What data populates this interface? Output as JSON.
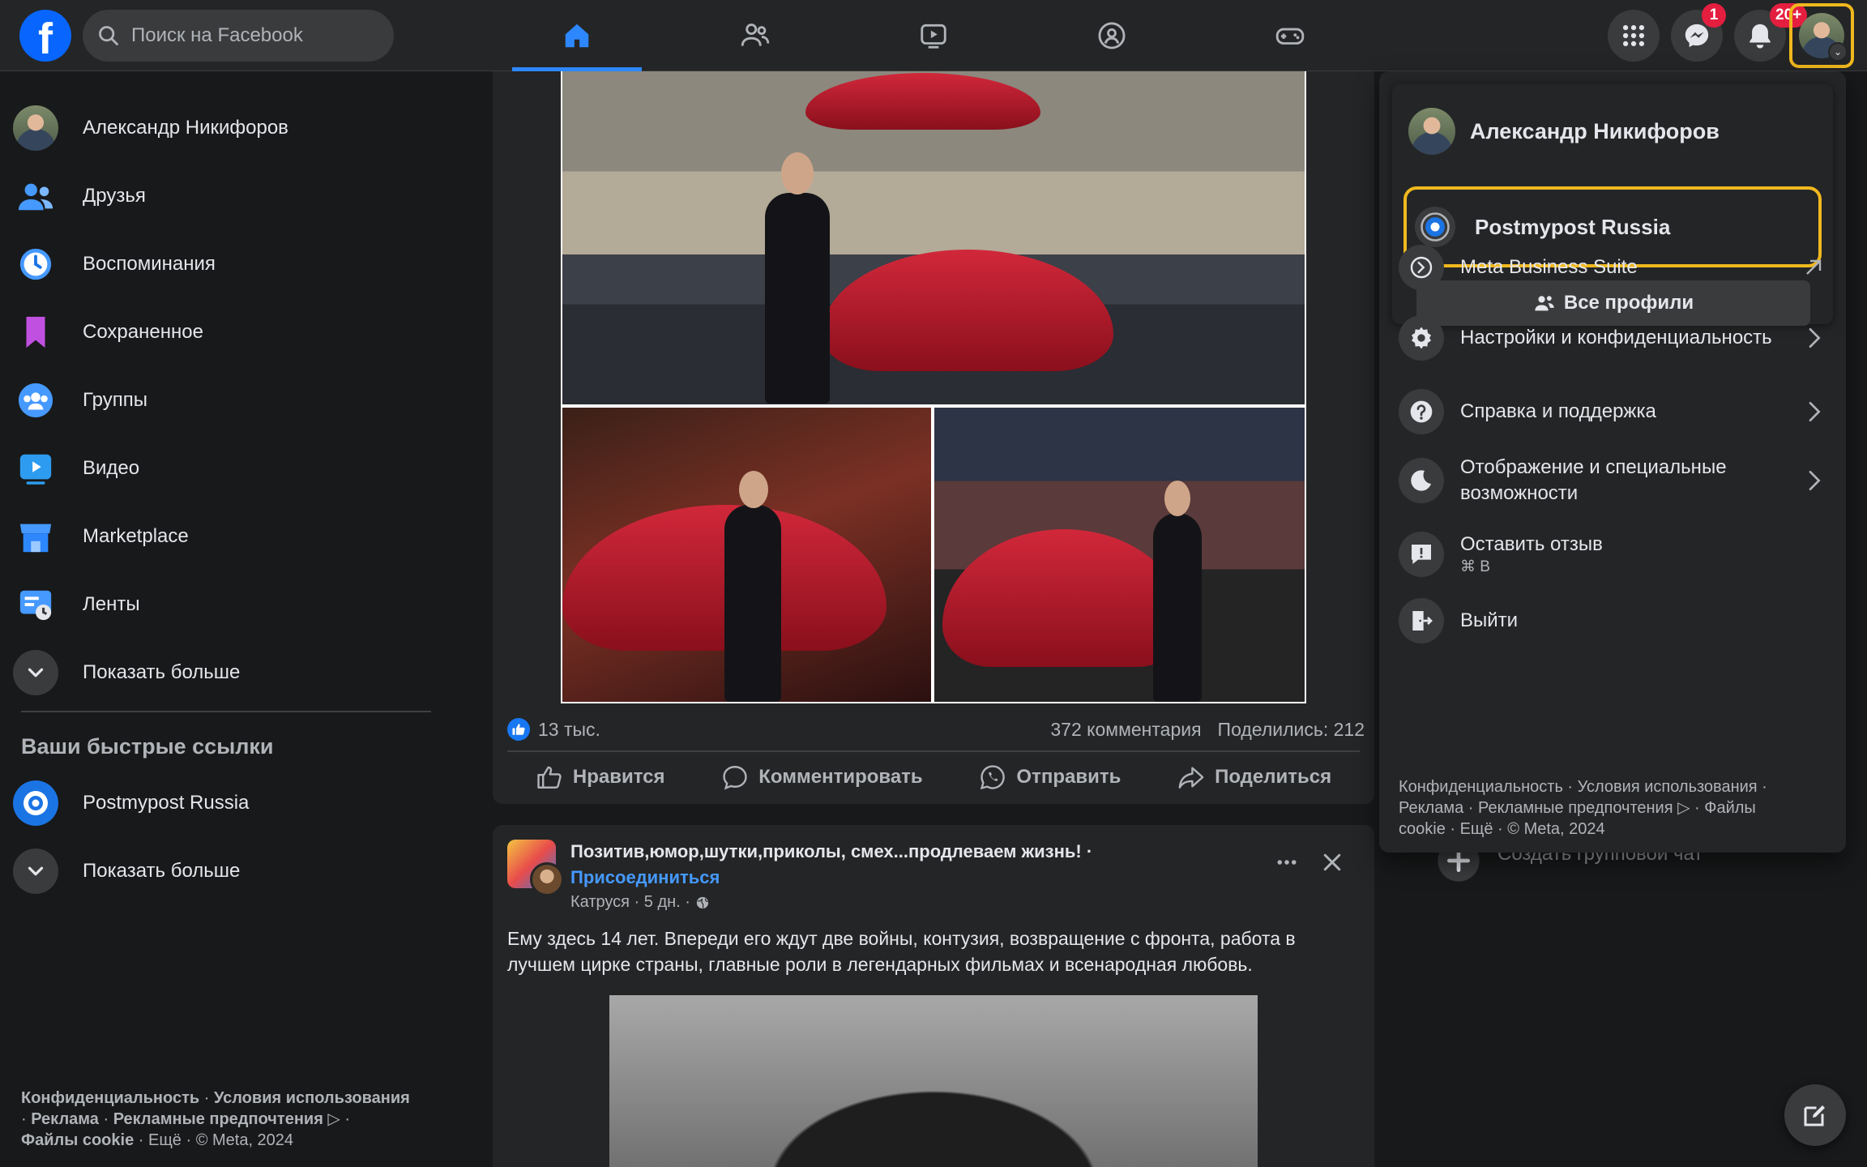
{
  "topbar": {
    "search_placeholder": "Поиск на Facebook",
    "notifications": {
      "messenger_count": "1",
      "bell_count": "20+"
    }
  },
  "left": {
    "items": [
      {
        "label": "Александр Никифоров",
        "icon": "profile-avatar"
      },
      {
        "label": "Друзья",
        "icon": "friends-icon"
      },
      {
        "label": "Воспоминания",
        "icon": "memories-clock-icon"
      },
      {
        "label": "Сохраненное",
        "icon": "saved-bookmark-icon"
      },
      {
        "label": "Группы",
        "icon": "groups-icon"
      },
      {
        "label": "Видео",
        "icon": "video-icon"
      },
      {
        "label": "Marketplace",
        "icon": "marketplace-shop-icon"
      },
      {
        "label": "Ленты",
        "icon": "feeds-icon"
      },
      {
        "label": "Показать больше",
        "icon": "chevron-down-icon"
      }
    ],
    "shortcuts_title": "Ваши быстрые ссылки",
    "shortcuts": [
      {
        "label": "Postmypost Russia"
      },
      {
        "label": "Показать больше"
      }
    ],
    "footer": {
      "privacy": "Конфиденциальность",
      "terms": "Условия использования",
      "ads": "Реклама",
      "ad_choices": "Рекламные предпочтения",
      "cookies": "Файлы cookie",
      "more": "Ещё",
      "copyright": "© Meta, 2024"
    }
  },
  "post1": {
    "likes": "13 тыс.",
    "comments": "372 комментария",
    "shares": "Поделились: 212",
    "actions": {
      "like": "Нравится",
      "comment": "Комментировать",
      "send": "Отправить",
      "share": "Поделиться"
    }
  },
  "post2": {
    "group": "Позитив,юмор,шутки,приколы, смех...продлеваем жизнь! ·",
    "join": "Присоединиться",
    "author_time": "Катруся · 5 дн. ·",
    "text": "Ему здесь 14 лет. Впереди его ждут две войны, контузия, возвращение с фронта, работа в лучшем цирке страны, главные роли в легендарных фильмах и всенародная любовь."
  },
  "right": {
    "hidden_item": "Создать групповой чат"
  },
  "menu": {
    "profile_name": "Александр Никифоров",
    "page_name": "Postmypost Russia",
    "all_profiles": "Все профили",
    "items": [
      {
        "label": "Meta Business Suite",
        "icon": "meta-business-icon",
        "arrow": "external-link-icon"
      },
      {
        "label": "Настройки и конфиденциальность",
        "icon": "gear-icon",
        "arrow": "chevron-right-icon"
      },
      {
        "label": "Справка и поддержка",
        "icon": "help-icon",
        "arrow": "chevron-right-icon"
      },
      {
        "label": "Отображение и специальные возможности",
        "icon": "moon-icon",
        "arrow": "chevron-right-icon"
      },
      {
        "label": "Оставить отзыв",
        "sub": "⌘ B",
        "icon": "feedback-icon"
      },
      {
        "label": "Выйти",
        "icon": "logout-icon"
      }
    ],
    "footer": {
      "line1": "Конфиденциальность · Условия использования ·",
      "line2": "Реклама · Рекламные предпочтения ▷ · Файлы",
      "line3": "cookie · Ещё · © Meta, 2024"
    }
  },
  "colors": {
    "accent": "#0866ff",
    "highlight_border": "#f0b81e",
    "background": "#18191a",
    "surface": "#242526"
  }
}
